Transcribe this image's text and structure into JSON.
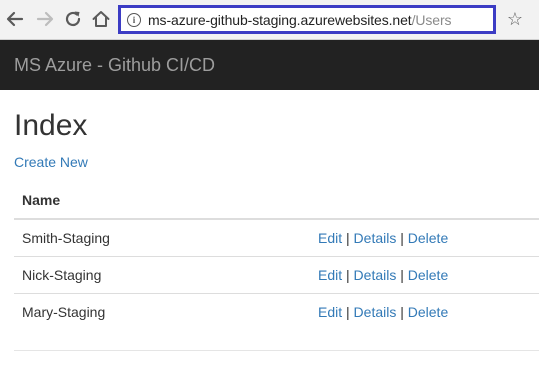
{
  "browser": {
    "url_host": "ms-azure-github-staging.azurewebsites.net",
    "url_path": "/Users"
  },
  "navbar": {
    "brand": "MS Azure - Github CI/CD"
  },
  "main": {
    "title": "Index",
    "create_link": "Create New",
    "table": {
      "columns": [
        "Name",
        ""
      ],
      "rows": [
        {
          "name": "Smith-Staging",
          "edit": "Edit",
          "details": "Details",
          "delete": "Delete"
        },
        {
          "name": "Nick-Staging",
          "edit": "Edit",
          "details": "Details",
          "delete": "Delete"
        },
        {
          "name": "Mary-Staging",
          "edit": "Edit",
          "details": "Details",
          "delete": "Delete"
        }
      ],
      "separator": "|"
    }
  },
  "colors": {
    "navbar_bg": "#222222",
    "link": "#337ab7",
    "address_highlight": "#3c3cc4"
  },
  "icons": {
    "back": "arrow-left-icon",
    "forward": "arrow-right-icon",
    "reload": "reload-icon",
    "home": "home-icon",
    "info": "info-icon",
    "bookmark": "star-icon"
  }
}
